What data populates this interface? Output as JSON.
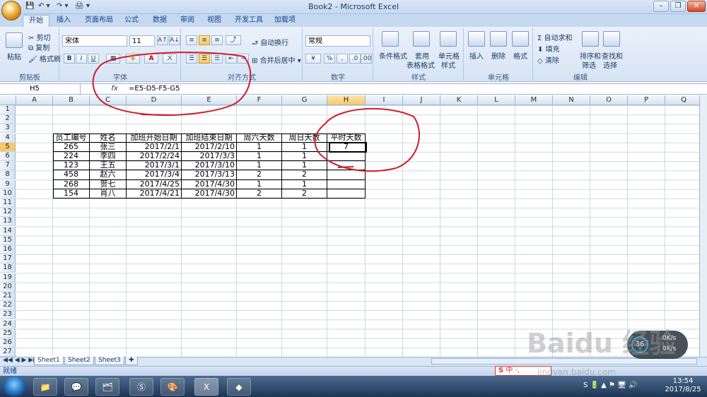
{
  "window": {
    "title": "Book2 - Microsoft Excel",
    "minimize": "–",
    "restore": "❐",
    "close": "✕"
  },
  "qat": {
    "save": "💾",
    "undo": "↶ ▾",
    "redo": "↷ ▾",
    "extra": "🖨 ▾"
  },
  "tabs": [
    "开始",
    "插入",
    "页面布局",
    "公式",
    "数据",
    "审阅",
    "视图",
    "开发工具",
    "加载项"
  ],
  "ribbon": {
    "clipboard": {
      "paste": "粘贴",
      "cut": "剪切",
      "copy": "复制",
      "format_painter": "格式刷",
      "label": "剪贴板"
    },
    "font": {
      "name": "宋体",
      "size": "11",
      "grow": "A↑",
      "shrink": "A↓",
      "bold": "B",
      "italic": "I",
      "underline": "U",
      "label": "字体"
    },
    "alignment": {
      "wrap": "自动换行",
      "merge": "合并后居中",
      "label": "对齐方式"
    },
    "number": {
      "format": "常规",
      "percent": "%",
      "comma": ",",
      "label": "数字"
    },
    "styles": {
      "conditional": "条件格式",
      "table": "套用",
      "table2": "表格格式",
      "cell": "单元格",
      "cell2": "样式",
      "label": "样式"
    },
    "cells": {
      "insert": "插入",
      "delete": "删除",
      "format": "格式",
      "label": "单元格"
    },
    "editing": {
      "autosum": "Σ 自动求和",
      "fill": "填充",
      "clear": "清除",
      "sort": "排序和",
      "sort2": "筛选",
      "find": "查找和",
      "find2": "选择",
      "label": "编辑"
    }
  },
  "formula": {
    "name_box": "H5",
    "fx": "fx",
    "text": "=E5-D5-F5-G5"
  },
  "columns": [
    "A",
    "B",
    "C",
    "D",
    "E",
    "F",
    "G",
    "H",
    "I",
    "J",
    "K",
    "L",
    "M",
    "N",
    "O",
    "P",
    "Q"
  ],
  "rows": [
    "1",
    "2",
    "3",
    "4",
    "5",
    "6",
    "7",
    "8",
    "9",
    "10",
    "11",
    "12",
    "13",
    "14",
    "15",
    "16",
    "17",
    "18",
    "19",
    "20",
    "21",
    "22",
    "23",
    "24",
    "25",
    "26",
    "27"
  ],
  "table": {
    "headers": [
      "员工编号",
      "姓名",
      "加班开始日期",
      "加班结束日期",
      "周六天数",
      "周日天数",
      "平时天数"
    ],
    "rows": [
      [
        "265",
        "张三",
        "2017/2/1",
        "2017/2/10",
        "1",
        "1",
        "7"
      ],
      [
        "224",
        "李四",
        "2017/2/24",
        "2017/3/3",
        "1",
        "1",
        ""
      ],
      [
        "123",
        "王五",
        "2017/3/1",
        "2017/3/10",
        "1",
        "1",
        ""
      ],
      [
        "458",
        "赵六",
        "2017/3/4",
        "2017/3/13",
        "2",
        "2",
        ""
      ],
      [
        "268",
        "贺七",
        "2017/4/25",
        "2017/4/30",
        "1",
        "1",
        ""
      ],
      [
        "154",
        "肖八",
        "2017/4/21",
        "2017/4/30",
        "2",
        "2",
        ""
      ]
    ]
  },
  "sheets": [
    "Sheet1",
    "Sheet2",
    "Sheet3"
  ],
  "status": "就绪",
  "netspeed": {
    "up": "0K/s",
    "down": "0K/s",
    "pct": "36"
  },
  "ime": "中 ·,",
  "clock": {
    "time": "13:54",
    "date": "2017/8/25"
  },
  "watermark": {
    "brand": "Baidu 经验",
    "url": "jingyan.baidu.com"
  },
  "annotation_color": "#cc1f2a"
}
